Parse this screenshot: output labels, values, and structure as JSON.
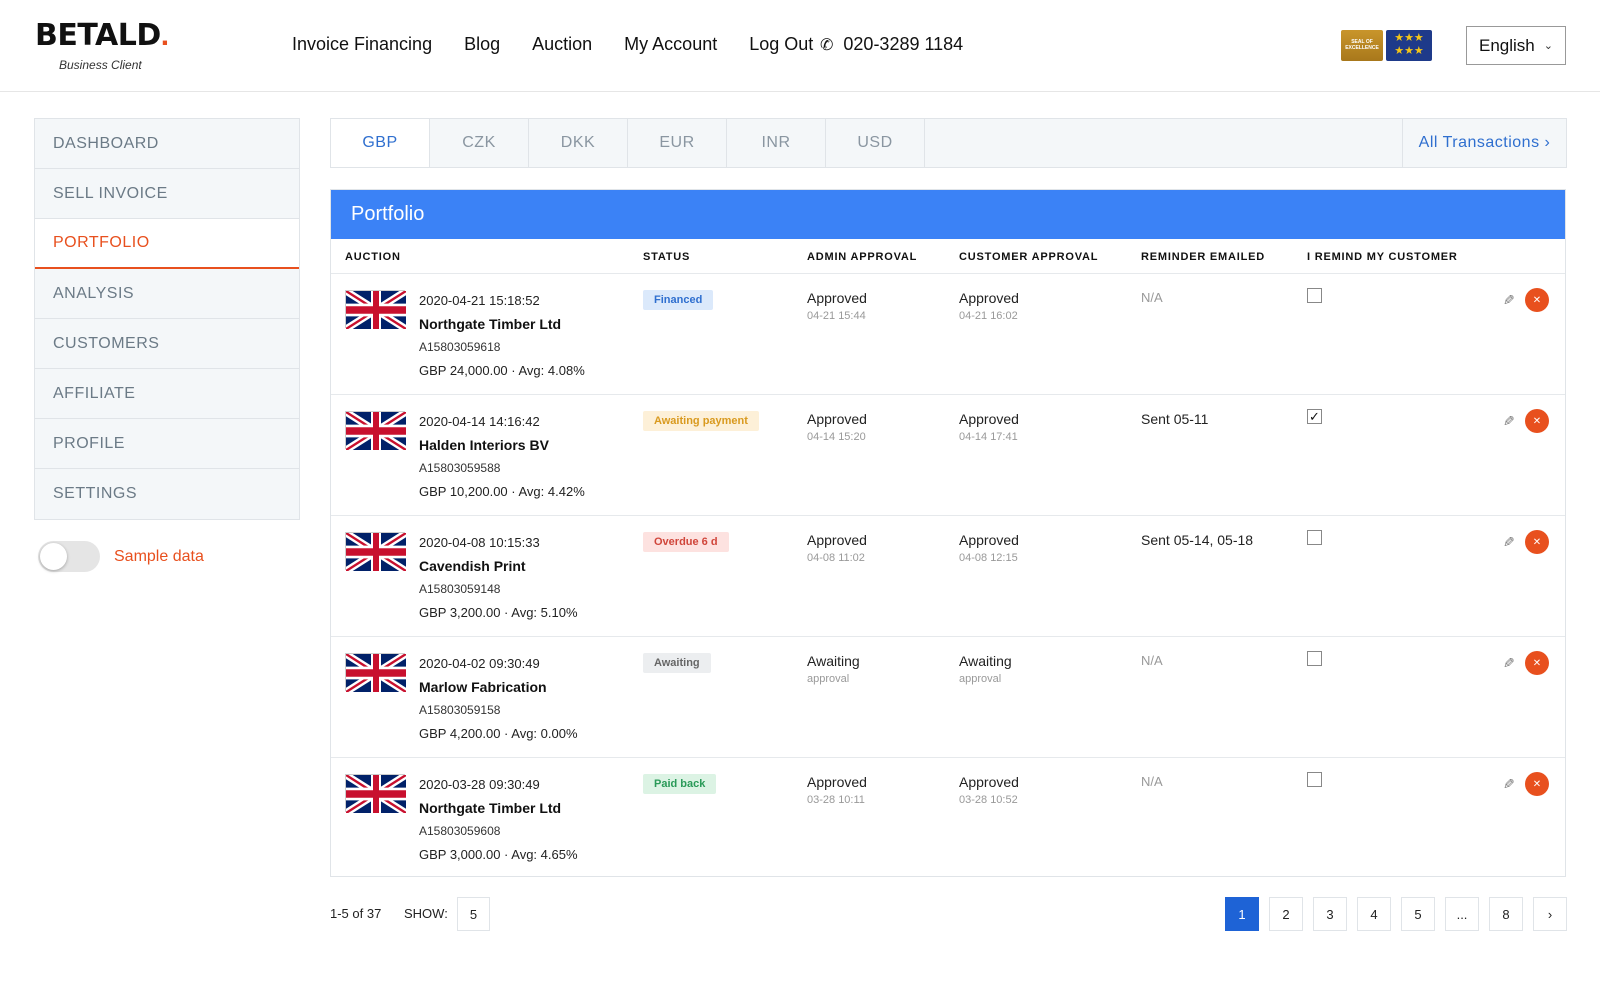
{
  "brand": {
    "name": "BETALD",
    "dot": ".",
    "subtitle": "Business Client"
  },
  "nav": [
    "Invoice Financing",
    "Blog",
    "Auction",
    "My Account",
    "Log Out"
  ],
  "phone": "020-3289 1184",
  "badges": {
    "seal": "SEAL OF EXCELLENCE",
    "stars": "★★★"
  },
  "language": "English",
  "sidebar": {
    "items": [
      {
        "label": "DASHBOARD"
      },
      {
        "label": "SELL INVOICE"
      },
      {
        "label": "PORTFOLIO"
      },
      {
        "label": "ANALYSIS"
      },
      {
        "label": "CUSTOMERS"
      },
      {
        "label": "AFFILIATE"
      },
      {
        "label": "PROFILE"
      },
      {
        "label": "SETTINGS"
      }
    ],
    "active_index": 2,
    "toggle_label": "Sample data",
    "toggle_on": false
  },
  "currency_tabs": [
    "GBP",
    "CZK",
    "DKK",
    "EUR",
    "INR",
    "USD"
  ],
  "active_tab": "GBP",
  "all_transactions": "All Transactions ›",
  "portfolio": {
    "title": "Portfolio",
    "columns": [
      "AUCTION",
      "STATUS",
      "ADMIN APPROVAL",
      "CUSTOMER APPROVAL",
      "REMINDER EMAILED",
      "I REMIND MY CUSTOMER"
    ],
    "rows": [
      {
        "date": "2020-04-21 15:18:52",
        "name": "Northgate Timber Ltd",
        "id": "A15803059618",
        "amount": "GBP 24,000.00 · Avg: 4.08%",
        "status": "Financed",
        "admin": "Approved",
        "admin_time": "04-21 15:44",
        "customer": "Approved",
        "customer_time": "04-21 16:02",
        "reminder": "N/A",
        "remind_checked": false
      },
      {
        "date": "2020-04-14 14:16:42",
        "name": "Halden Interiors BV",
        "id": "A15803059588",
        "amount": "GBP 10,200.00 · Avg: 4.42%",
        "status": "Awaiting payment",
        "admin": "Approved",
        "admin_time": "04-14 15:20",
        "customer": "Approved",
        "customer_time": "04-14 17:41",
        "reminder": "Sent 05-11",
        "remind_checked": true
      },
      {
        "date": "2020-04-08 10:15:33",
        "name": "Cavendish Print",
        "id": "A15803059148",
        "amount": "GBP 3,200.00 · Avg: 5.10%",
        "status": "Overdue 6 d",
        "admin": "Approved",
        "admin_time": "04-08 11:02",
        "customer": "Approved",
        "customer_time": "04-08 12:15",
        "reminder": "Sent 05-14, 05-18",
        "remind_checked": false
      },
      {
        "date": "2020-04-02 09:30:49",
        "name": "Marlow Fabrication",
        "id": "A15803059158",
        "amount": "GBP 4,200.00 · Avg: 0.00%",
        "status": "Awaiting",
        "admin": "Awaiting",
        "admin_time": "approval",
        "customer": "Awaiting",
        "customer_time": "approval",
        "reminder": "N/A",
        "remind_checked": false
      },
      {
        "date": "2020-03-28 09:30:49",
        "name": "Northgate Timber Ltd",
        "id": "A15803059608",
        "amount": "GBP 3,000.00 · Avg: 4.65%",
        "status": "Paid back",
        "admin": "Approved",
        "admin_time": "03-28 10:11",
        "customer": "Approved",
        "customer_time": "03-28 10:52",
        "reminder": "N/A",
        "remind_checked": false
      }
    ]
  },
  "footer": {
    "count": "1-5 of 37",
    "show_label": "SHOW:",
    "show_value": "5",
    "pages": [
      "1",
      "2",
      "3",
      "4",
      "5",
      "...",
      "8",
      "›"
    ],
    "active_page": "1"
  },
  "colors": {
    "accent": "#e8501e",
    "primary": "#3b82f6",
    "link": "#2f6fcf"
  }
}
